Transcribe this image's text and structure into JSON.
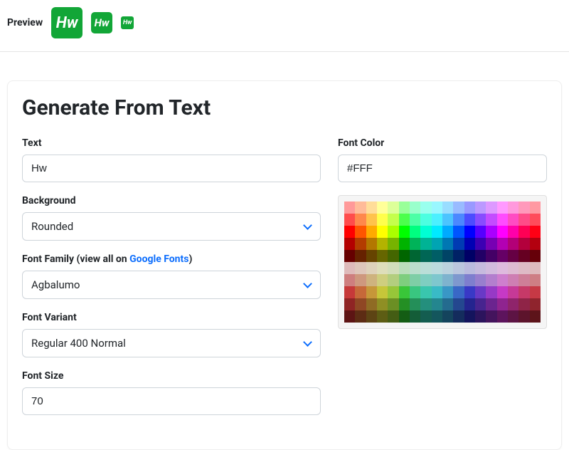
{
  "preview": {
    "label": "Preview",
    "icon_text": "Hw"
  },
  "card": {
    "title": "Generate From Text"
  },
  "left": {
    "text_label": "Text",
    "text_value": "Hw",
    "background_label": "Background",
    "background_value": "Rounded",
    "font_family_label_pre": "Font Family (view all on ",
    "font_family_link": "Google Fonts",
    "font_family_label_post": ")",
    "font_family_value": "Agbalumo",
    "font_variant_label": "Font Variant",
    "font_variant_value": "Regular 400 Normal",
    "font_size_label": "Font Size",
    "font_size_value": "70"
  },
  "right": {
    "font_color_label": "Font Color",
    "font_color_value": "#FFF"
  },
  "palette_hues": [
    0,
    20,
    40,
    60,
    80,
    120,
    150,
    170,
    185,
    200,
    220,
    240,
    260,
    280,
    300,
    320,
    340,
    355
  ],
  "palette_rows": [
    {
      "s": 100,
      "l": 80
    },
    {
      "s": 100,
      "l": 65
    },
    {
      "s": 100,
      "l": 50
    },
    {
      "s": 100,
      "l": 35
    },
    {
      "s": 100,
      "l": 20
    },
    {
      "s": 35,
      "l": 80
    },
    {
      "s": 45,
      "l": 65
    },
    {
      "s": 55,
      "l": 50
    },
    {
      "s": 60,
      "l": 35
    },
    {
      "s": 65,
      "l": 22
    }
  ]
}
